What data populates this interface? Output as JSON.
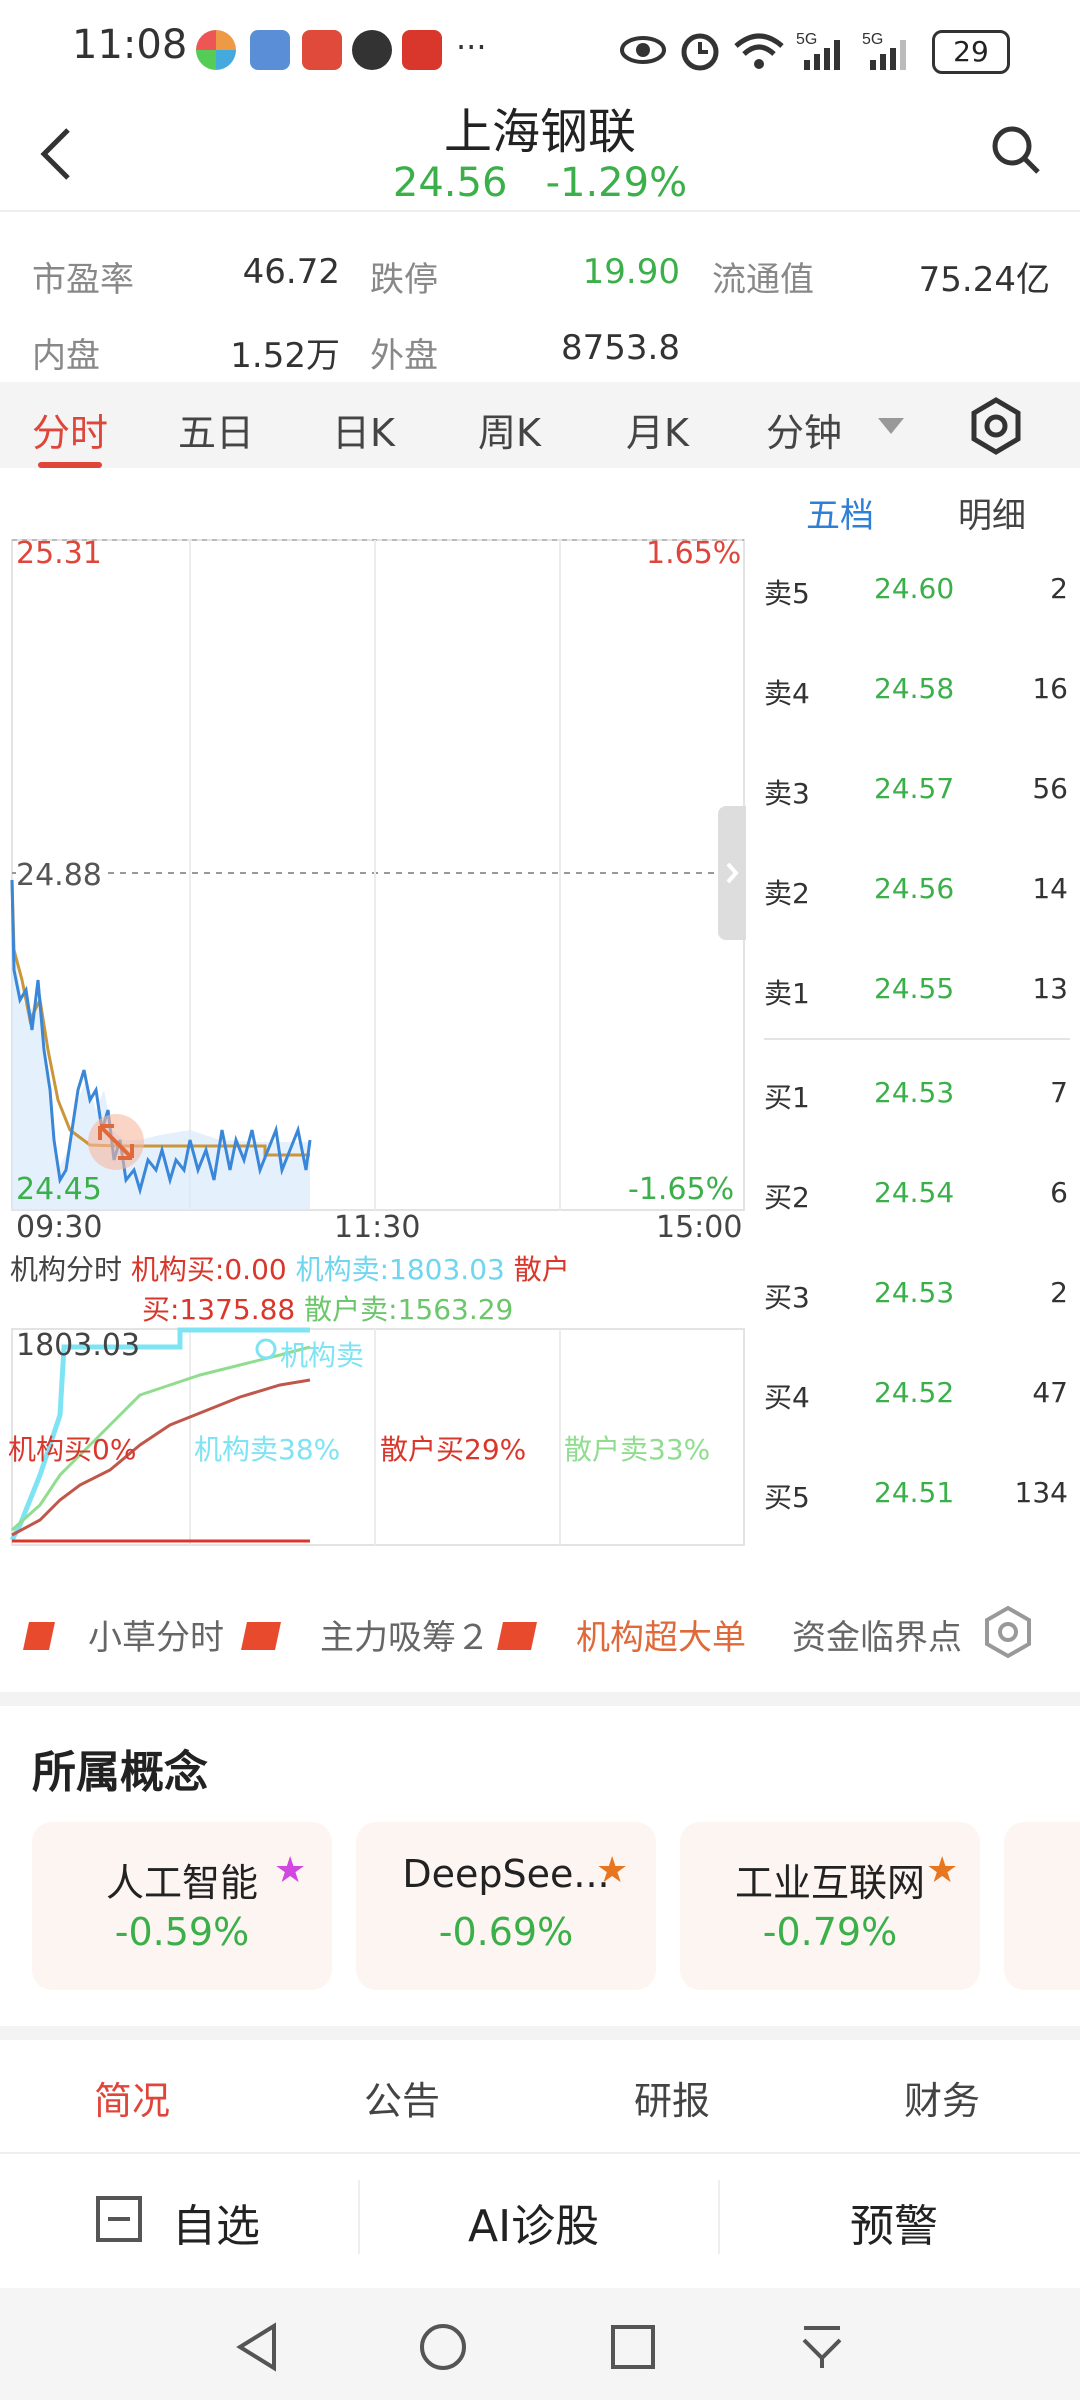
{
  "status": {
    "time": "11:08",
    "battery": "29"
  },
  "header": {
    "title": "上海钢联",
    "price": "24.56",
    "change": "-1.29%"
  },
  "stats": [
    {
      "label": "市盈率",
      "value": "46.72"
    },
    {
      "label": "跌停",
      "value": "19.90"
    },
    {
      "label": "流通值",
      "value": "75.24亿"
    },
    {
      "label": "内盘",
      "value": "1.52万"
    },
    {
      "label": "外盘",
      "value": "8753.8"
    }
  ],
  "tabs": [
    "分时",
    "五日",
    "日K",
    "周K",
    "月K",
    "分钟"
  ],
  "orderbook_tabs": [
    "五档",
    "明细"
  ],
  "chart": {
    "high": "25.31",
    "mid": "24.88",
    "low": "24.45",
    "pct_high": "1.65%",
    "pct_low": "-1.65%",
    "times": [
      "09:30",
      "11:30",
      "15:00"
    ]
  },
  "flow": {
    "title": "机构分时",
    "inst_buy": "机构买:0.00",
    "inst_sell": "机构卖:1803.03",
    "retail_label": "散户",
    "retail_buy": "买:1375.88",
    "retail_sell": "散户卖:1563.29",
    "max": "1803.03",
    "legend_inst_sell": "机构卖",
    "pct_inst_buy": "机构买0%",
    "pct_inst_sell": "机构卖38%",
    "pct_retail_buy": "散户买29%",
    "pct_retail_sell": "散户卖33%"
  },
  "orderbook": [
    {
      "label": "卖5",
      "price": "24.60",
      "vol": "2"
    },
    {
      "label": "卖4",
      "price": "24.58",
      "vol": "16"
    },
    {
      "label": "卖3",
      "price": "24.57",
      "vol": "56"
    },
    {
      "label": "卖2",
      "price": "24.56",
      "vol": "14"
    },
    {
      "label": "卖1",
      "price": "24.55",
      "vol": "13"
    },
    {
      "label": "买1",
      "price": "24.53",
      "vol": "7"
    },
    {
      "label": "买2",
      "price": "24.54",
      "vol": "6"
    },
    {
      "label": "买3",
      "price": "24.53",
      "vol": "2"
    },
    {
      "label": "买4",
      "price": "24.52",
      "vol": "47"
    },
    {
      "label": "买5",
      "price": "24.51",
      "vol": "134"
    }
  ],
  "indicators": [
    "小草分时",
    "主力吸筹２",
    "机构超大单",
    "资金临界点"
  ],
  "concepts": {
    "title": "所属概念",
    "items": [
      {
        "name": "人工智能",
        "change": "-0.59%"
      },
      {
        "name": "DeepSee...",
        "change": "-0.69%"
      },
      {
        "name": "工业互联网",
        "change": "-0.79%"
      }
    ]
  },
  "bottom_tabs": [
    "简况",
    "公告",
    "研报",
    "财务"
  ],
  "actions": [
    "自选",
    "AI诊股",
    "预警"
  ],
  "colors": {
    "up": "#e0453a",
    "down": "#3bb04a",
    "accent": "#e0453a",
    "link": "#2f7fd6"
  }
}
